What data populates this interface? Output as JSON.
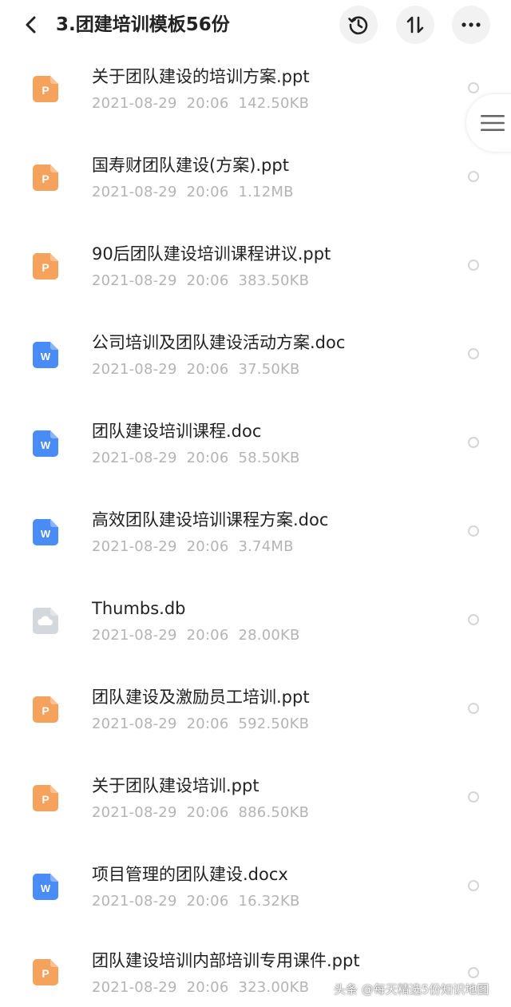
{
  "header": {
    "title": "3.团建培训模板56份",
    "back_icon": "chevron-left-icon",
    "history_icon": "history-icon",
    "sort_icon": "sort-icon",
    "more_icon": "more-horizontal-icon"
  },
  "colors": {
    "ppt_icon": "#f5a25d",
    "doc_icon": "#4a8cf5",
    "other_icon": "#d4d7dc"
  },
  "files": [
    {
      "name": "关于团队建设的培训方案.ppt",
      "date": "2021-08-29",
      "time": "20:06",
      "size": "142.50KB",
      "type": "ppt"
    },
    {
      "name": "国寿财团队建设(方案).ppt",
      "date": "2021-08-29",
      "time": "20:06",
      "size": "1.12MB",
      "type": "ppt"
    },
    {
      "name": "90后团队建设培训课程讲议.ppt",
      "date": "2021-08-29",
      "time": "20:06",
      "size": "383.50KB",
      "type": "ppt"
    },
    {
      "name": "公司培训及团队建设活动方案.doc",
      "date": "2021-08-29",
      "time": "20:06",
      "size": "37.50KB",
      "type": "doc"
    },
    {
      "name": "团队建设培训课程.doc",
      "date": "2021-08-29",
      "time": "20:06",
      "size": "58.50KB",
      "type": "doc"
    },
    {
      "name": "高效团队建设培训课程方案.doc",
      "date": "2021-08-29",
      "time": "20:06",
      "size": "3.74MB",
      "type": "doc"
    },
    {
      "name": "Thumbs.db",
      "date": "2021-08-29",
      "time": "20:06",
      "size": "28.00KB",
      "type": "other"
    },
    {
      "name": "团队建设及激励员工培训.ppt",
      "date": "2021-08-29",
      "time": "20:06",
      "size": "592.50KB",
      "type": "ppt"
    },
    {
      "name": "关于团队建设培训.ppt",
      "date": "2021-08-29",
      "time": "20:06",
      "size": "886.50KB",
      "type": "ppt"
    },
    {
      "name": "项目管理的团队建设.docx",
      "date": "2021-08-29",
      "time": "20:06",
      "size": "16.32KB",
      "type": "doc"
    },
    {
      "name": "团队建设培训内部培训专用课件.ppt",
      "date": "2021-08-29",
      "time": "20:06",
      "size": "323.00KB",
      "type": "ppt"
    }
  ],
  "side_handle_icon": "menu-icon",
  "watermark": "头条 @每天精选5份知识地图"
}
